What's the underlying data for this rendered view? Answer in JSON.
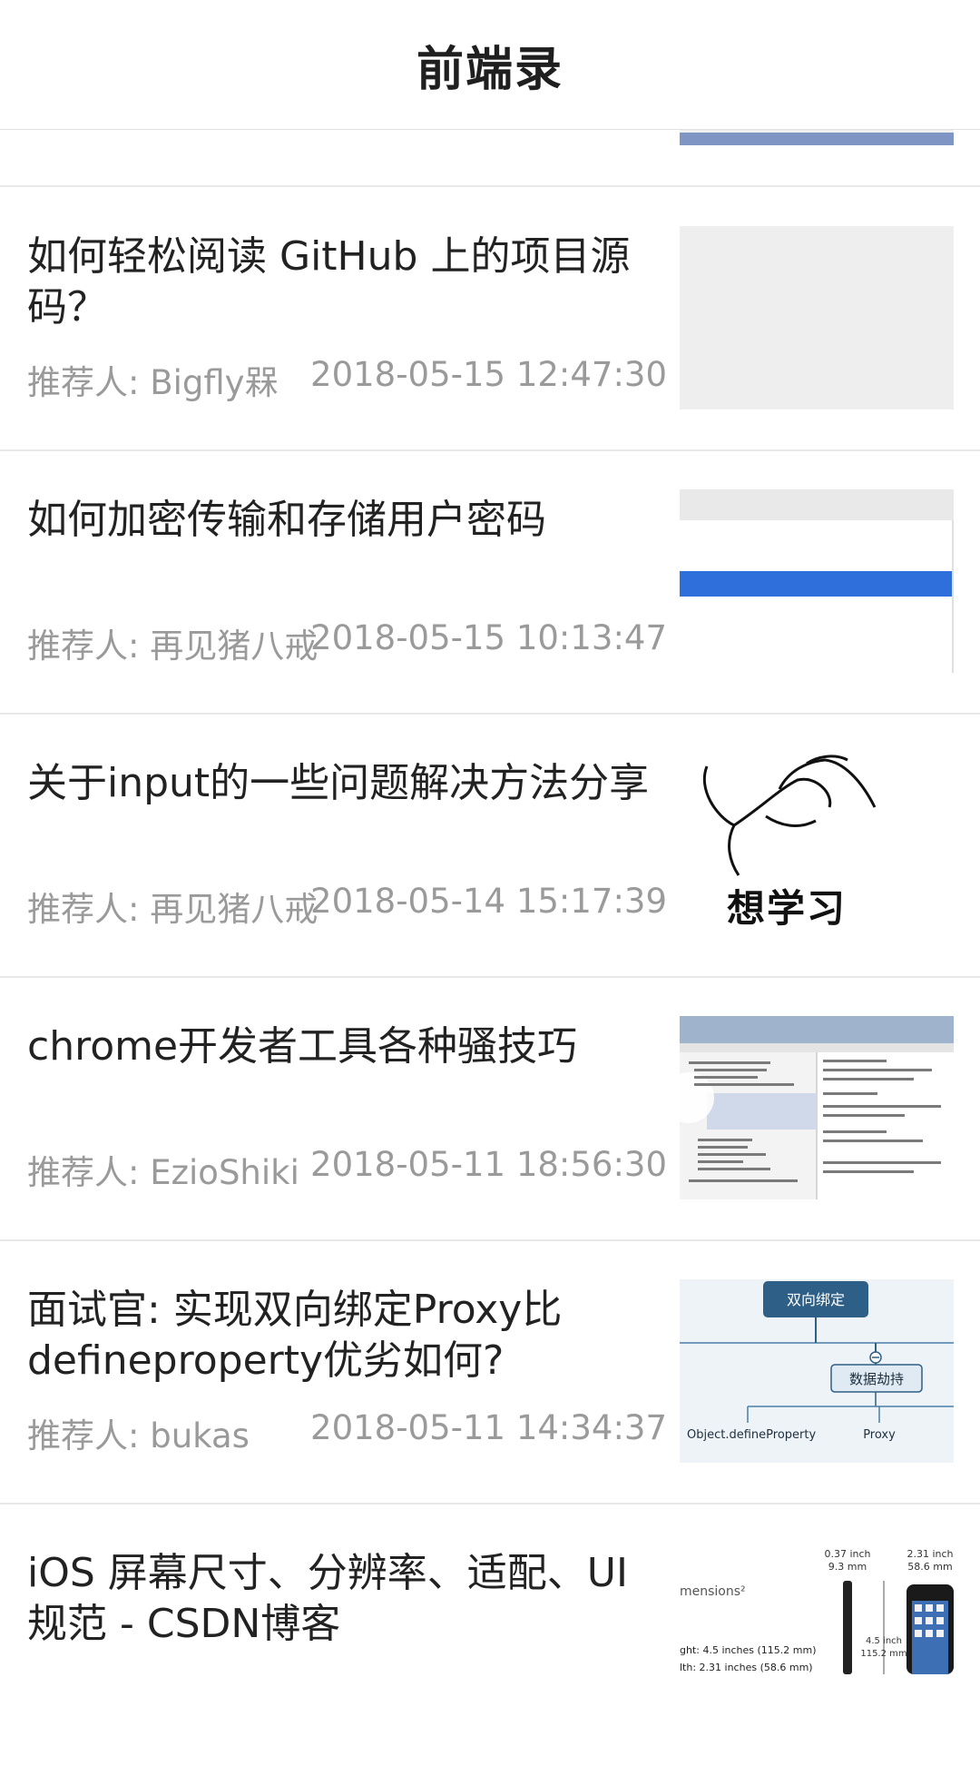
{
  "header": {
    "title": "前端录"
  },
  "articles": [
    {
      "title": "如何轻松阅读 GitHub 上的项目源码？",
      "recommender": "推荐人: Bigfly槑",
      "date": "2018-05-15 12:47:30"
    },
    {
      "title": "如何加密传输和存储用户密码",
      "recommender": "推荐人: 再见猪八戒",
      "date": "2018-05-15 10:13:47"
    },
    {
      "title": "关于input的一些问题解决方法分享",
      "recommender": "推荐人: 再见猪八戒",
      "date": "2018-05-14 15:17:39",
      "thumb_text": "想学习"
    },
    {
      "title": "chrome开发者工具各种骚技巧",
      "recommender": "推荐人: EzioShiki",
      "date": "2018-05-11 18:56:30"
    },
    {
      "title": "面试官: 实现双向绑定Proxy比defineproperty优劣如何?",
      "recommender": "推荐人: bukas",
      "date": "2018-05-11 14:34:37",
      "thumb_labels": {
        "top": "双向绑定",
        "middle": "数据劫持",
        "left": "Object.defineProperty",
        "right": "Proxy"
      }
    },
    {
      "title": "iOS 屏幕尺寸、分辨率、适配、UI规范 - CSDN博客",
      "thumb_labels": {
        "w1": "0.37 inch",
        "w1mm": "9.3 mm",
        "w2": "2.31 inch",
        "w2mm": "58.6 mm",
        "dims": "mensions²",
        "height": "ght: 4.5 inches (115.2 mm)",
        "width": "lth: 2.31 inches (58.6 mm)",
        "side": "4.5 inch",
        "side_mm": "115.2 mm"
      }
    }
  ]
}
